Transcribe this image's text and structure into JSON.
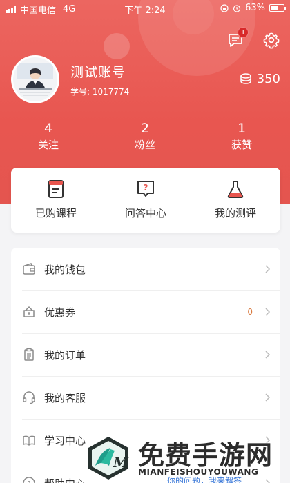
{
  "status_bar": {
    "carrier": "中国电信",
    "network": "4G",
    "time": "下午 2:24",
    "battery": "63%",
    "battery_level": 0.63
  },
  "header": {
    "message_badge": "1",
    "username": "测试账号",
    "student_id": "学号: 1017774",
    "coins": "350"
  },
  "stats": [
    {
      "value": "4",
      "label": "关注"
    },
    {
      "value": "2",
      "label": "粉丝"
    },
    {
      "value": "1",
      "label": "获赞"
    }
  ],
  "quick_actions": [
    {
      "label": "已购课程",
      "icon": "book-icon"
    },
    {
      "label": "问答中心",
      "icon": "question-bubble-icon"
    },
    {
      "label": "我的测评",
      "icon": "flask-icon"
    }
  ],
  "menu": [
    {
      "label": "我的钱包",
      "icon": "wallet-icon"
    },
    {
      "label": "优惠券",
      "icon": "coupon-icon",
      "count": "0"
    },
    {
      "label": "我的订单",
      "icon": "order-icon"
    },
    {
      "label": "我的客服",
      "icon": "headset-icon"
    },
    {
      "label": "学习中心",
      "icon": "open-book-icon"
    },
    {
      "label": "帮助中心",
      "icon": "help-icon"
    }
  ],
  "watermark": {
    "title": "免费手游网",
    "subtitle": "MIANFEISHOUYOUWANG"
  },
  "overlay_text": "你的问题，我来解答"
}
